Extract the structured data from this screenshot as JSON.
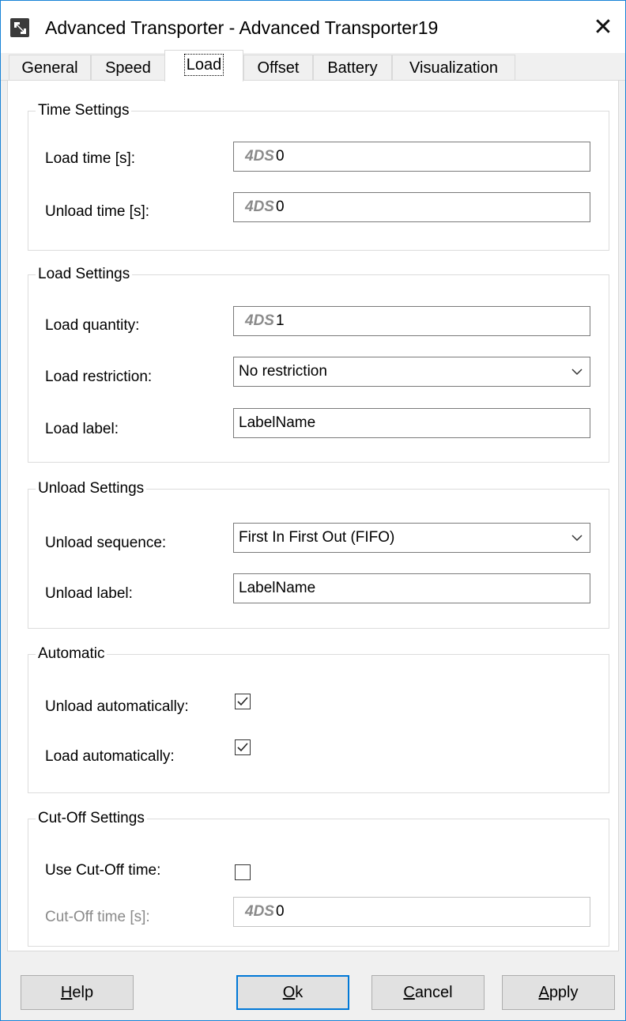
{
  "window": {
    "title": "Advanced Transporter - Advanced Transporter19",
    "close_glyph": "✕",
    "accent_color": "#1883d7"
  },
  "tabs": [
    {
      "label": "General",
      "active": false
    },
    {
      "label": "Speed",
      "active": false
    },
    {
      "label": "Load",
      "active": true
    },
    {
      "label": "Offset",
      "active": false
    },
    {
      "label": "Battery",
      "active": false
    },
    {
      "label": "Visualization",
      "active": false
    }
  ],
  "time_settings": {
    "title": "Time Settings",
    "load_time": {
      "label": "Load time [s]:",
      "prefix": "4DS",
      "value": "0"
    },
    "unload_time": {
      "label": "Unload time [s]:",
      "prefix": "4DS",
      "value": "0"
    }
  },
  "load_settings": {
    "title": "Load Settings",
    "quantity": {
      "label": "Load quantity:",
      "prefix": "4DS",
      "value": "1"
    },
    "restriction": {
      "label": "Load restriction:",
      "value": "No restriction"
    },
    "label_field": {
      "label": "Load label:",
      "value": "LabelName"
    }
  },
  "unload_settings": {
    "title": "Unload Settings",
    "sequence": {
      "label": "Unload sequence:",
      "value": "First In First Out (FIFO)"
    },
    "label_field": {
      "label": "Unload label:",
      "value": "LabelName"
    }
  },
  "automatic": {
    "title": "Automatic",
    "unload_auto": {
      "label": "Unload automatically:",
      "checked": true
    },
    "load_auto": {
      "label": "Load automatically:",
      "checked": true
    }
  },
  "cutoff": {
    "title": "Cut-Off Settings",
    "use_cutoff": {
      "label": "Use Cut-Off time:",
      "checked": false
    },
    "cutoff_time": {
      "label": "Cut-Off time [s]:",
      "prefix": "4DS",
      "value": "0",
      "disabled": true
    }
  },
  "buttons": {
    "help": {
      "label": "Help",
      "mnemonic": "H",
      "rest": "elp"
    },
    "ok": {
      "label": "Ok",
      "mnemonic": "O",
      "rest": "k"
    },
    "cancel": {
      "label": "Cancel",
      "mnemonic": "C",
      "rest": "ancel"
    },
    "apply": {
      "label": "Apply",
      "mnemonic": "A",
      "rest": "pply"
    }
  },
  "icons": {
    "app": "transporter-app-icon",
    "chevron": "chevron-down-icon",
    "check": "checkmark-icon"
  }
}
